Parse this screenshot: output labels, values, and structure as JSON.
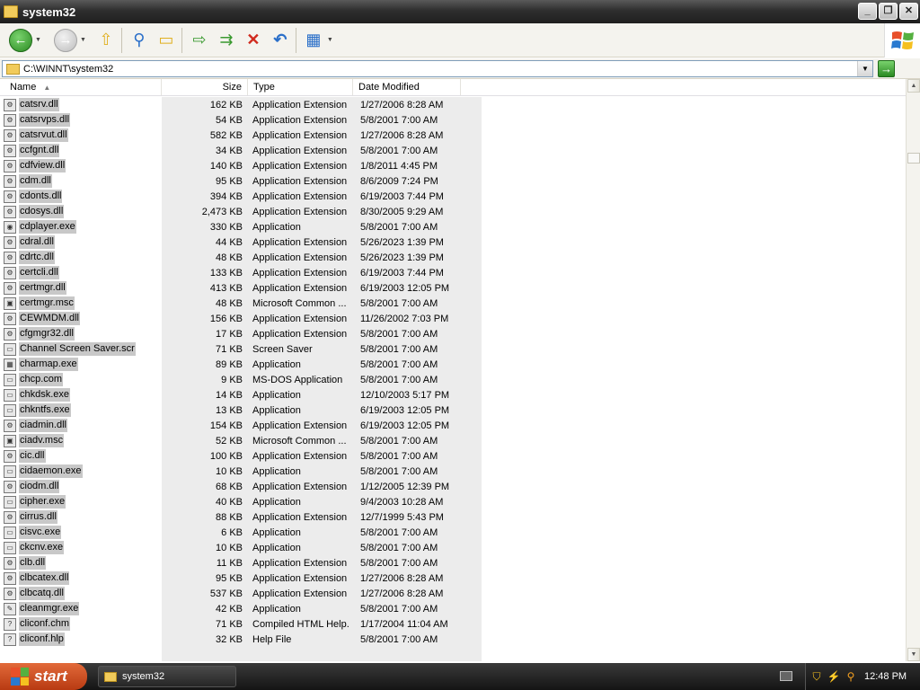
{
  "window": {
    "title": "system32"
  },
  "address": {
    "value": "C:\\WINNT\\system32"
  },
  "columns": {
    "name": "Name",
    "size": "Size",
    "type": "Type",
    "date": "Date Modified"
  },
  "files": [
    {
      "name": "catsrv.dll",
      "size": "162 KB",
      "type": "Application Extension",
      "date": "1/27/2006 8:28 AM",
      "icon": "dll-icon"
    },
    {
      "name": "catsrvps.dll",
      "size": "54 KB",
      "type": "Application Extension",
      "date": "5/8/2001 7:00 AM",
      "icon": "dll-icon"
    },
    {
      "name": "catsrvut.dll",
      "size": "582 KB",
      "type": "Application Extension",
      "date": "1/27/2006 8:28 AM",
      "icon": "dll-icon"
    },
    {
      "name": "ccfgnt.dll",
      "size": "34 KB",
      "type": "Application Extension",
      "date": "5/8/2001 7:00 AM",
      "icon": "dll-icon"
    },
    {
      "name": "cdfview.dll",
      "size": "140 KB",
      "type": "Application Extension",
      "date": "1/8/2011 4:45 PM",
      "icon": "dll-icon"
    },
    {
      "name": "cdm.dll",
      "size": "95 KB",
      "type": "Application Extension",
      "date": "8/6/2009 7:24 PM",
      "icon": "dll-icon"
    },
    {
      "name": "cdonts.dll",
      "size": "394 KB",
      "type": "Application Extension",
      "date": "6/19/2003 7:44 PM",
      "icon": "dll-icon"
    },
    {
      "name": "cdosys.dll",
      "size": "2,473 KB",
      "type": "Application Extension",
      "date": "8/30/2005 9:29 AM",
      "icon": "dll-icon"
    },
    {
      "name": "cdplayer.exe",
      "size": "330 KB",
      "type": "Application",
      "date": "5/8/2001 7:00 AM",
      "icon": "cd-player-icon"
    },
    {
      "name": "cdral.dll",
      "size": "44 KB",
      "type": "Application Extension",
      "date": "5/26/2023 1:39 PM",
      "icon": "dll-icon"
    },
    {
      "name": "cdrtc.dll",
      "size": "48 KB",
      "type": "Application Extension",
      "date": "5/26/2023 1:39 PM",
      "icon": "dll-icon"
    },
    {
      "name": "certcli.dll",
      "size": "133 KB",
      "type": "Application Extension",
      "date": "6/19/2003 7:44 PM",
      "icon": "dll-icon"
    },
    {
      "name": "certmgr.dll",
      "size": "413 KB",
      "type": "Application Extension",
      "date": "6/19/2003 12:05 PM",
      "icon": "dll-icon"
    },
    {
      "name": "certmgr.msc",
      "size": "48 KB",
      "type": "Microsoft Common ...",
      "date": "5/8/2001 7:00 AM",
      "icon": "msc-icon"
    },
    {
      "name": "CEWMDM.dll",
      "size": "156 KB",
      "type": "Application Extension",
      "date": "11/26/2002 7:03 PM",
      "icon": "dll-icon"
    },
    {
      "name": "cfgmgr32.dll",
      "size": "17 KB",
      "type": "Application Extension",
      "date": "5/8/2001 7:00 AM",
      "icon": "dll-icon"
    },
    {
      "name": "Channel Screen Saver.scr",
      "size": "71 KB",
      "type": "Screen Saver",
      "date": "5/8/2001 7:00 AM",
      "icon": "monitor-icon"
    },
    {
      "name": "charmap.exe",
      "size": "89 KB",
      "type": "Application",
      "date": "5/8/2001 7:00 AM",
      "icon": "charmap-icon"
    },
    {
      "name": "chcp.com",
      "size": "9 KB",
      "type": "MS-DOS Application",
      "date": "5/8/2001 7:00 AM",
      "icon": "exe-icon"
    },
    {
      "name": "chkdsk.exe",
      "size": "14 KB",
      "type": "Application",
      "date": "12/10/2003 5:17 PM",
      "icon": "exe-icon"
    },
    {
      "name": "chkntfs.exe",
      "size": "13 KB",
      "type": "Application",
      "date": "6/19/2003 12:05 PM",
      "icon": "exe-icon"
    },
    {
      "name": "ciadmin.dll",
      "size": "154 KB",
      "type": "Application Extension",
      "date": "6/19/2003 12:05 PM",
      "icon": "dll-icon"
    },
    {
      "name": "ciadv.msc",
      "size": "52 KB",
      "type": "Microsoft Common ...",
      "date": "5/8/2001 7:00 AM",
      "icon": "msc-icon"
    },
    {
      "name": "cic.dll",
      "size": "100 KB",
      "type": "Application Extension",
      "date": "5/8/2001 7:00 AM",
      "icon": "dll-icon"
    },
    {
      "name": "cidaemon.exe",
      "size": "10 KB",
      "type": "Application",
      "date": "5/8/2001 7:00 AM",
      "icon": "exe-icon"
    },
    {
      "name": "ciodm.dll",
      "size": "68 KB",
      "type": "Application Extension",
      "date": "1/12/2005 12:39 PM",
      "icon": "dll-icon"
    },
    {
      "name": "cipher.exe",
      "size": "40 KB",
      "type": "Application",
      "date": "9/4/2003 10:28 AM",
      "icon": "exe-icon"
    },
    {
      "name": "cirrus.dll",
      "size": "88 KB",
      "type": "Application Extension",
      "date": "12/7/1999 5:43 PM",
      "icon": "dll-icon"
    },
    {
      "name": "cisvc.exe",
      "size": "6 KB",
      "type": "Application",
      "date": "5/8/2001 7:00 AM",
      "icon": "exe-icon"
    },
    {
      "name": "ckcnv.exe",
      "size": "10 KB",
      "type": "Application",
      "date": "5/8/2001 7:00 AM",
      "icon": "exe-icon"
    },
    {
      "name": "clb.dll",
      "size": "11 KB",
      "type": "Application Extension",
      "date": "5/8/2001 7:00 AM",
      "icon": "dll-icon"
    },
    {
      "name": "clbcatex.dll",
      "size": "95 KB",
      "type": "Application Extension",
      "date": "1/27/2006 8:28 AM",
      "icon": "dll-icon"
    },
    {
      "name": "clbcatq.dll",
      "size": "537 KB",
      "type": "Application Extension",
      "date": "1/27/2006 8:28 AM",
      "icon": "dll-icon"
    },
    {
      "name": "cleanmgr.exe",
      "size": "42 KB",
      "type": "Application",
      "date": "5/8/2001 7:00 AM",
      "icon": "cleanmgr-icon"
    },
    {
      "name": "cliconf.chm",
      "size": "71 KB",
      "type": "Compiled HTML Help...",
      "date": "1/17/2004 11:04 AM",
      "icon": "chm-icon"
    },
    {
      "name": "cliconf.hlp",
      "size": "32 KB",
      "type": "Help File",
      "date": "5/8/2001 7:00 AM",
      "icon": "help-icon"
    }
  ],
  "taskbar": {
    "start": "start",
    "task": "system32",
    "clock": "12:48 PM"
  }
}
